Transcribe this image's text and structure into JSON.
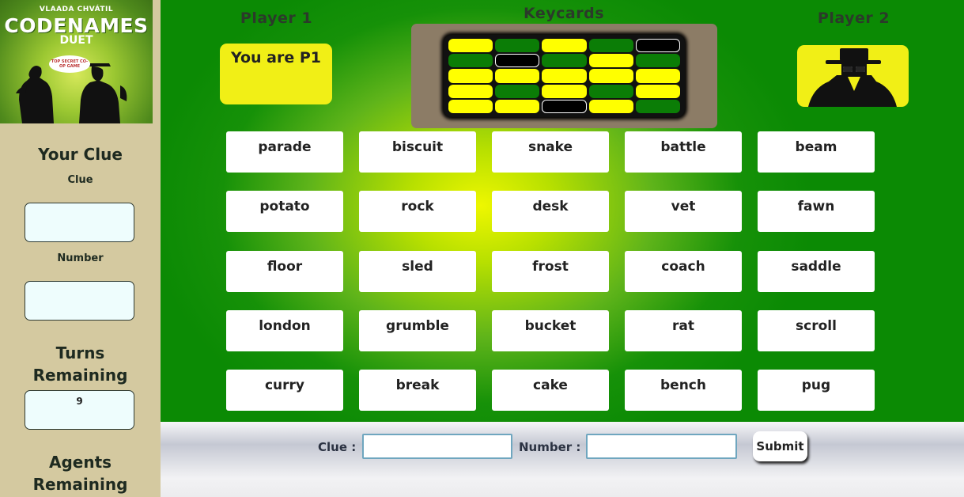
{
  "logo": {
    "author": "VLAADA CHVÁTIL",
    "title": "CODENAMES",
    "subtitle": "DUET",
    "bubble": "TOP SECRET CO-OP GAME"
  },
  "sidebar": {
    "your_clue_heading": "Your Clue",
    "clue_label": "Clue",
    "clue_value": "",
    "number_label": "Number",
    "number_value": "",
    "turns_heading_line1": "Turns",
    "turns_heading_line2": "Remaining",
    "turns_value": "9",
    "agents_heading_line1": "Agents",
    "agents_heading_line2": "Remaining"
  },
  "header": {
    "player1_title": "Player 1",
    "player1_card": "You are P1",
    "keycards_title": "Keycards",
    "player2_title": "Player 2"
  },
  "keycard": {
    "rows": [
      [
        "yellow",
        "green",
        "yellow",
        "green",
        "black"
      ],
      [
        "green",
        "black",
        "green",
        "yellow",
        "green"
      ],
      [
        "yellow",
        "yellow",
        "yellow",
        "yellow",
        "yellow"
      ],
      [
        "yellow",
        "green",
        "yellow",
        "green",
        "yellow"
      ],
      [
        "yellow",
        "yellow",
        "black",
        "yellow",
        "green"
      ]
    ]
  },
  "words": [
    [
      "parade",
      "biscuit",
      "snake",
      "battle",
      "beam"
    ],
    [
      "potato",
      "rock",
      "desk",
      "vet",
      "fawn"
    ],
    [
      "floor",
      "sled",
      "frost",
      "coach",
      "saddle"
    ],
    [
      "london",
      "grumble",
      "bucket",
      "rat",
      "scroll"
    ],
    [
      "curry",
      "break",
      "cake",
      "bench",
      "pug"
    ]
  ],
  "bottom_bar": {
    "clue_label": "Clue :",
    "clue_value": "",
    "number_label": "Number :",
    "number_value": "",
    "submit_label": "Submit"
  },
  "colors": {
    "card_yellow": "#f1ef16",
    "key_yellow": "#ffff00",
    "key_green": "#0b7d06",
    "sidebar_bg": "#d4c9a0"
  }
}
